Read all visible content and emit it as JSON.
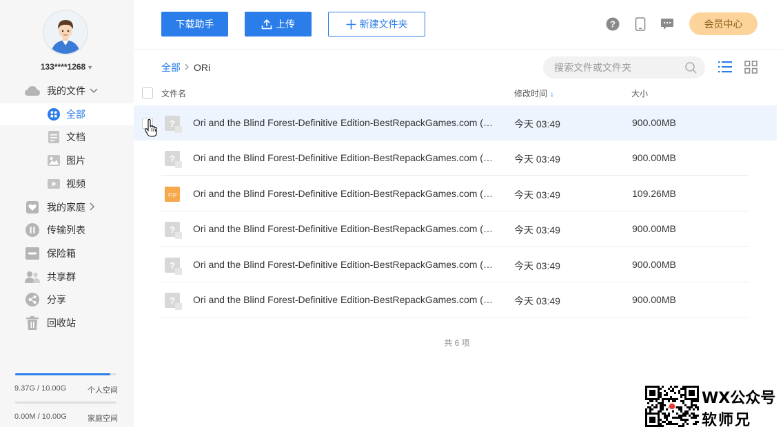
{
  "sidebar": {
    "username": "133****1268",
    "nav": [
      {
        "label": "我的文件",
        "icon": "cloud-icon"
      },
      {
        "label": "全部",
        "icon": "grid-icon"
      },
      {
        "label": "文档",
        "icon": "document-icon"
      },
      {
        "label": "图片",
        "icon": "image-icon"
      },
      {
        "label": "视频",
        "icon": "video-icon"
      },
      {
        "label": "我的家庭",
        "icon": "heart-icon"
      },
      {
        "label": "传输列表",
        "icon": "transfer-icon"
      },
      {
        "label": "保险箱",
        "icon": "safe-icon"
      },
      {
        "label": "共享群",
        "icon": "group-icon"
      },
      {
        "label": "分享",
        "icon": "share-icon"
      },
      {
        "label": "回收站",
        "icon": "trash-icon"
      }
    ],
    "personal_quota": {
      "used": "9.37G / 10.00G",
      "label": "个人空间",
      "fraction": 0.937
    },
    "family_quota": {
      "used": "0.00M / 10.00G",
      "label": "家庭空间",
      "fraction": 0.0
    }
  },
  "toolbar": {
    "download_label": "下载助手",
    "upload_label": "上传",
    "new_folder_label": "新建文件夹",
    "vip_label": "会员中心"
  },
  "breadcrumb": {
    "root": "全部",
    "current": "ORi"
  },
  "search": {
    "placeholder": "搜索文件或文件夹"
  },
  "table": {
    "headers": {
      "name": "文件名",
      "time": "修改时间",
      "size": "大小"
    },
    "rows": [
      {
        "name": "Ori and the Blind Forest-Definitive Edition-BestRepackGames.com (…",
        "time": "今天  03:49",
        "size": "900.00MB",
        "type": "unknown"
      },
      {
        "name": "Ori and the Blind Forest-Definitive Edition-BestRepackGames.com (…",
        "time": "今天  03:49",
        "size": "900.00MB",
        "type": "unknown"
      },
      {
        "name": "Ori and the Blind Forest-Definitive Edition-BestRepackGames.com (…",
        "time": "今天  03:49",
        "size": "109.26MB",
        "type": "zip"
      },
      {
        "name": "Ori and the Blind Forest-Definitive Edition-BestRepackGames.com (…",
        "time": "今天  03:49",
        "size": "900.00MB",
        "type": "unknown"
      },
      {
        "name": "Ori and the Blind Forest-Definitive Edition-BestRepackGames.com (…",
        "time": "今天  03:49",
        "size": "900.00MB",
        "type": "unknown"
      },
      {
        "name": "Ori and the Blind Forest-Definitive Edition-BestRepackGames.com (…",
        "time": "今天  03:49",
        "size": "900.00MB",
        "type": "unknown"
      }
    ],
    "zip_badge": "zip",
    "unknown_badge": "?"
  },
  "footer": {
    "count": "共 6 项"
  },
  "watermark": {
    "line1": "WX公众号",
    "line2": "软师兄"
  },
  "colors": {
    "accent": "#2b7de9",
    "vip_bg": "#fcd49b"
  }
}
